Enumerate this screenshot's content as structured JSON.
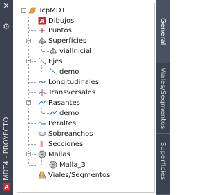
{
  "window": {
    "title": "MDT4 - PROYECTO",
    "close_glyph": "✕",
    "settings_glyph": "⚙",
    "autocad_badge": "A"
  },
  "tabs": [
    {
      "label": "General",
      "active": true
    },
    {
      "label": "Viales/Segmentos",
      "active": false
    },
    {
      "label": "Superficies",
      "active": false
    }
  ],
  "tree": {
    "root": {
      "label": "TcpMDT",
      "icon": "project-icon",
      "expanded": true
    },
    "items": [
      {
        "label": "Dibujos",
        "icon": "autocad-drawing-icon",
        "level": 1,
        "expandable": false
      },
      {
        "label": "Puntos",
        "icon": "points-icon",
        "level": 1,
        "expandable": false
      },
      {
        "label": "Superficies",
        "icon": "surface-icon",
        "level": 1,
        "expandable": true,
        "expanded": true
      },
      {
        "label": "vialInicial",
        "icon": "surface-icon",
        "level": 2,
        "expandable": false
      },
      {
        "label": "Ejes",
        "icon": "alignment-icon",
        "level": 1,
        "expandable": true,
        "expanded": true
      },
      {
        "label": "demo",
        "icon": "alignment-icon",
        "level": 2,
        "expandable": false
      },
      {
        "label": "Longitudinales",
        "icon": "longitudinal-profile-icon",
        "level": 1,
        "expandable": false
      },
      {
        "label": "Transversales",
        "icon": "cross-section-icon",
        "level": 1,
        "expandable": false
      },
      {
        "label": "Rasantes",
        "icon": "grade-line-icon",
        "level": 1,
        "expandable": true,
        "expanded": true
      },
      {
        "label": "demo",
        "icon": "grade-line-icon",
        "level": 2,
        "expandable": false
      },
      {
        "label": "Peraltes",
        "icon": "superelevation-icon",
        "level": 1,
        "expandable": false
      },
      {
        "label": "Sobreanchos",
        "icon": "widening-icon",
        "level": 1,
        "expandable": false
      },
      {
        "label": "Secciones",
        "icon": "sections-icon",
        "level": 1,
        "expandable": false
      },
      {
        "label": "Mallas",
        "icon": "mesh-icon",
        "level": 1,
        "expandable": true,
        "expanded": true
      },
      {
        "label": "Malla_3",
        "icon": "mesh-icon",
        "level": 2,
        "expandable": false
      },
      {
        "label": "Viales/Segmentos",
        "icon": "road-icon",
        "level": 1,
        "expandable": false
      }
    ]
  },
  "colors": {
    "panel_dark": "#3c4350",
    "accent_red": "#d8232a",
    "root_icon": "#e0a03a"
  }
}
